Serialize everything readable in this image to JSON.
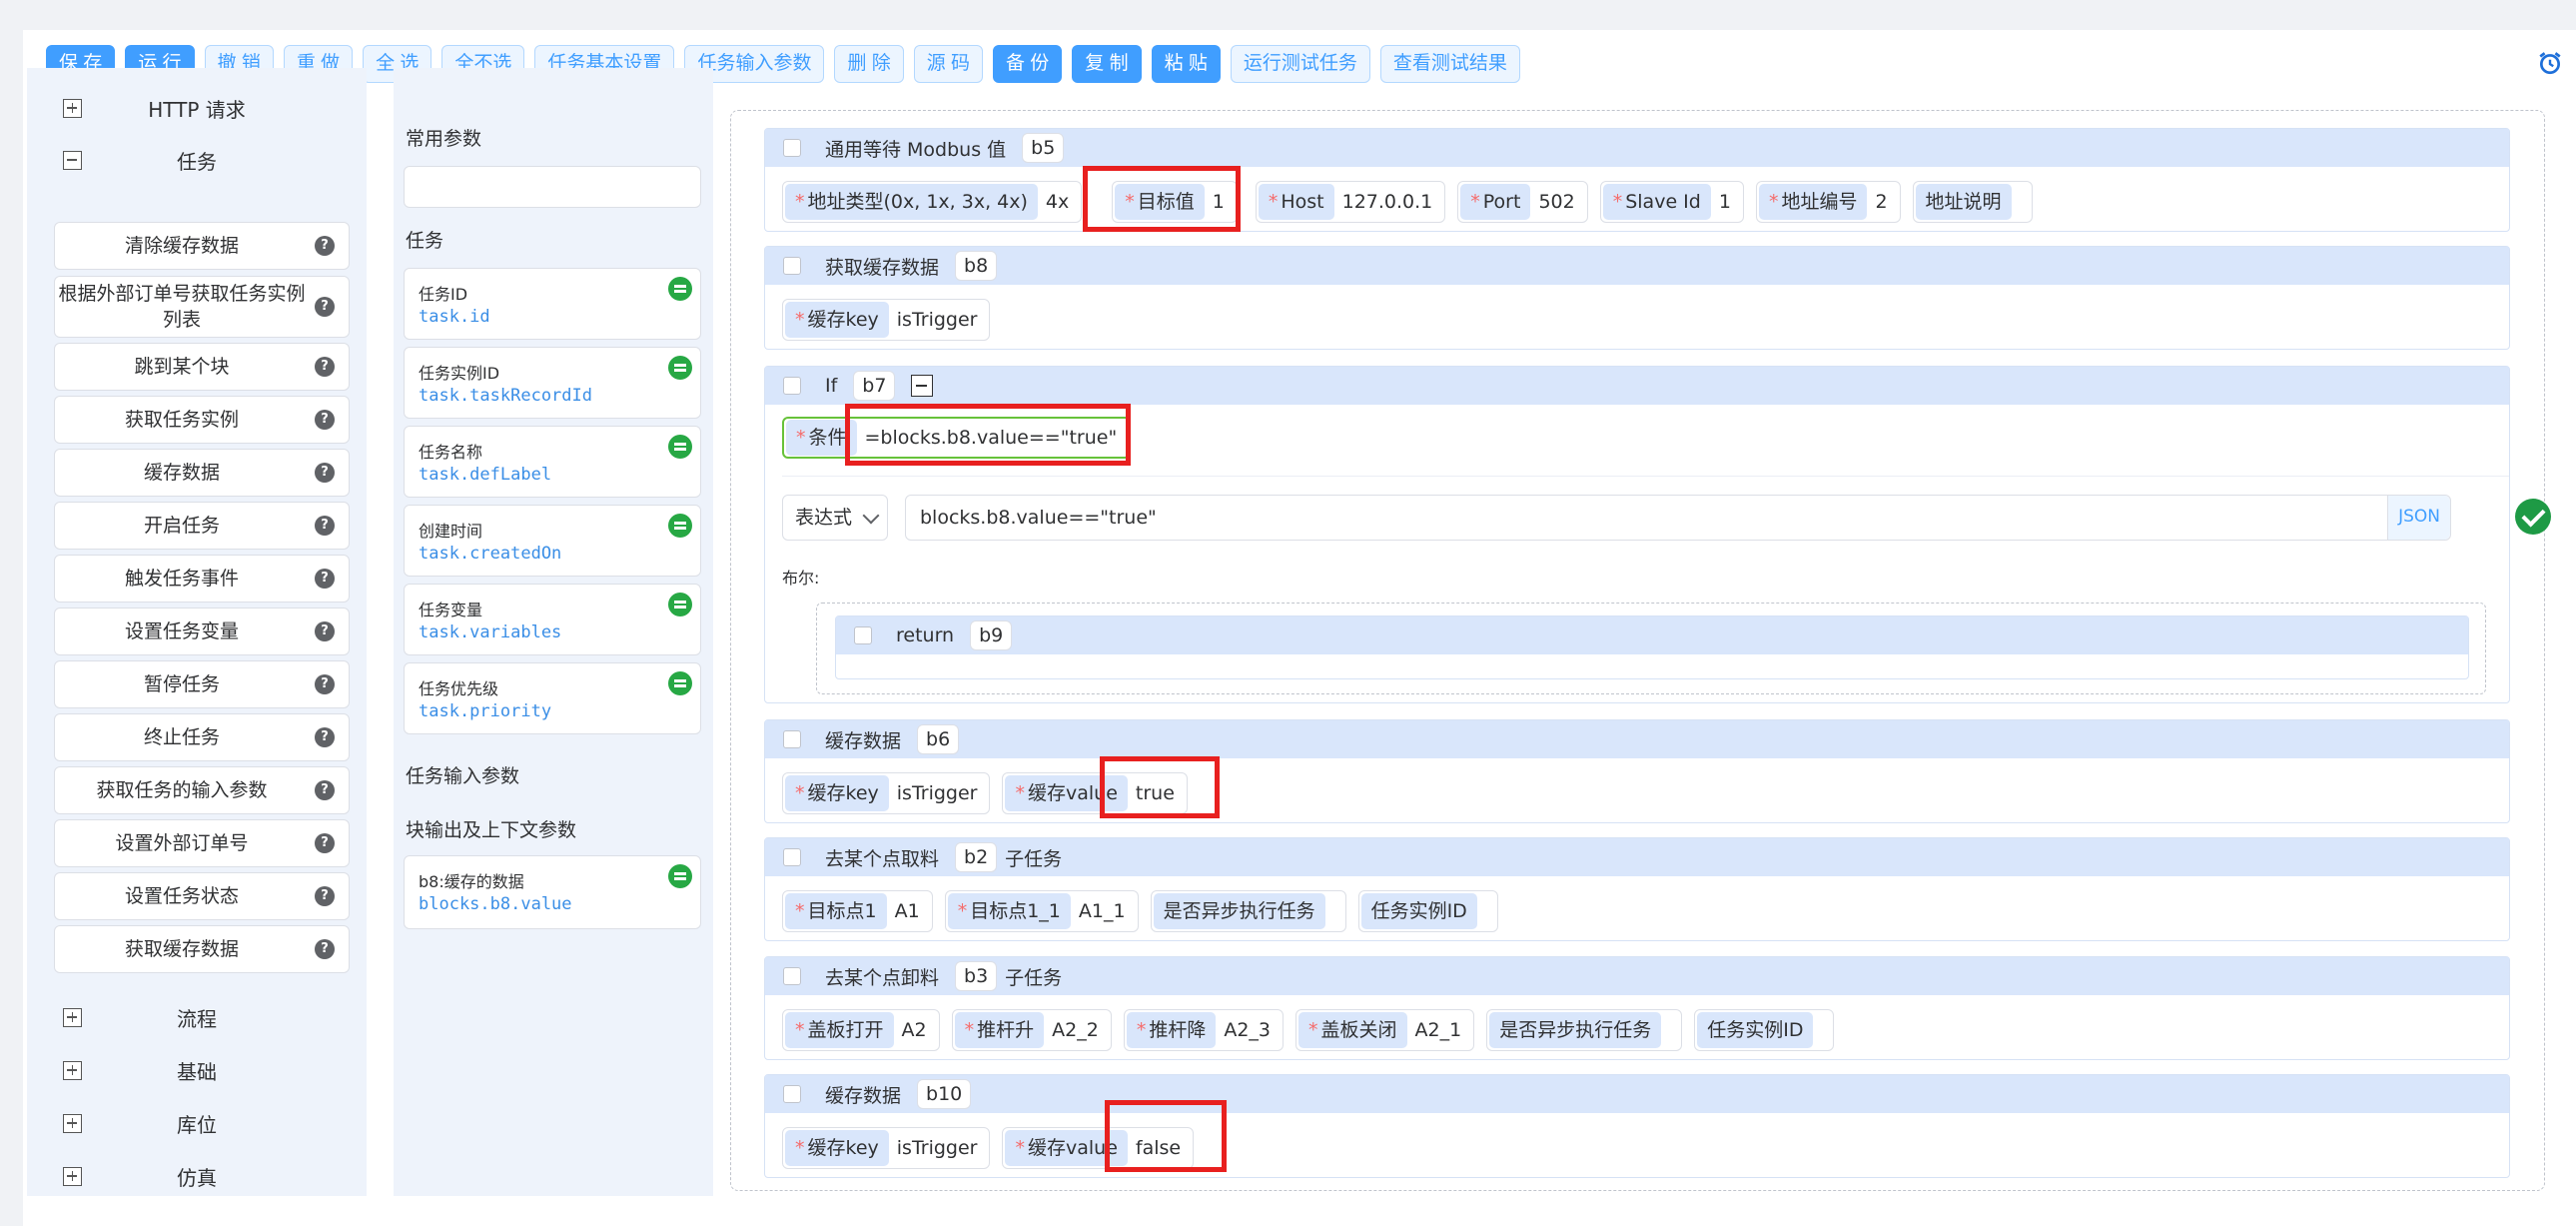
{
  "toolbar": {
    "buttons": [
      "保 存",
      "运 行",
      "撤 销",
      "重 做",
      "全 选",
      "全不选",
      "任务基本设置",
      "任务输入参数",
      "删 除",
      "源 码",
      "备 份",
      "复 制",
      "粘 贴",
      "运行测试任务",
      "查看测试结果"
    ]
  },
  "nav": {
    "groups_top": [
      "HTTP 请求",
      "任务"
    ],
    "task_items": [
      "清除缓存数据",
      "根据外部订单号获取任务实例列表",
      "跳到某个块",
      "获取任务实例",
      "缓存数据",
      "开启任务",
      "触发任务事件",
      "设置任务变量",
      "暂停任务",
      "终止任务",
      "获取任务的输入参数",
      "设置外部订单号",
      "设置任务状态",
      "获取缓存数据"
    ],
    "groups_bottom": [
      "流程",
      "基础",
      "库位",
      "仿真"
    ]
  },
  "params": {
    "common_title": "常用参数",
    "task_title": "任务",
    "cards": [
      {
        "title": "任务ID",
        "expr": "task.id"
      },
      {
        "title": "任务实例ID",
        "expr": "task.taskRecordId"
      },
      {
        "title": "任务名称",
        "expr": "task.defLabel"
      },
      {
        "title": "创建时间",
        "expr": "task.createdOn"
      },
      {
        "title": "任务变量",
        "expr": "task.variables"
      },
      {
        "title": "任务优先级",
        "expr": "task.priority"
      }
    ],
    "input_title": "任务输入参数",
    "output_title": "块输出及上下文参数",
    "out_card": {
      "title": "b8:缓存的数据",
      "expr": "blocks.b8.value"
    }
  },
  "blocks": {
    "b5": {
      "title": "通用等待 Modbus 值",
      "id": "b5",
      "fields": [
        {
          "k": "地址类型(0x, 1x, 3x, 4x)",
          "v": "4x"
        },
        {
          "k": "目标值",
          "v": "1"
        },
        {
          "k": "Host",
          "v": "127.0.0.1"
        },
        {
          "k": "Port",
          "v": "502"
        },
        {
          "k": "Slave Id",
          "v": "1"
        },
        {
          "k": "地址编号",
          "v": "2"
        },
        {
          "k": "地址说明",
          "v": ""
        }
      ]
    },
    "b8": {
      "title": "获取缓存数据",
      "id": "b8",
      "fields": [
        {
          "k": "缓存key",
          "v": "isTrigger"
        }
      ]
    },
    "b7": {
      "title": "If",
      "id": "b7",
      "cond_key": "条件",
      "cond_value": "=blocks.b8.value==\"true\"",
      "expr_type": "表达式",
      "expr_value": "blocks.b8.value==\"true\"",
      "json_label": "JSON",
      "bool_label": "布尔:",
      "inner": {
        "title": "return",
        "id": "b9"
      }
    },
    "b6": {
      "title": "缓存数据",
      "id": "b6",
      "fields": [
        {
          "k": "缓存key",
          "v": "isTrigger"
        },
        {
          "k": "缓存value",
          "v": "true"
        }
      ]
    },
    "b2": {
      "title": "去某个点取料",
      "id": "b2",
      "tag": "子任务",
      "fields": [
        {
          "k": "目标点1",
          "v": "A1"
        },
        {
          "k": "目标点1_1",
          "v": "A1_1"
        },
        {
          "k": "是否异步执行任务",
          "v": ""
        },
        {
          "k": "任务实例ID",
          "v": ""
        }
      ]
    },
    "b3": {
      "title": "去某个点卸料",
      "id": "b3",
      "tag": "子任务",
      "fields": [
        {
          "k": "盖板打开",
          "v": "A2"
        },
        {
          "k": "推杆升",
          "v": "A2_2"
        },
        {
          "k": "推杆降",
          "v": "A2_3"
        },
        {
          "k": "盖板关闭",
          "v": "A2_1"
        },
        {
          "k": "是否异步执行任务",
          "v": ""
        },
        {
          "k": "任务实例ID",
          "v": ""
        }
      ]
    },
    "b10": {
      "title": "缓存数据",
      "id": "b10",
      "fields": [
        {
          "k": "缓存key",
          "v": "isTrigger"
        },
        {
          "k": "缓存value",
          "v": "false"
        }
      ]
    }
  }
}
